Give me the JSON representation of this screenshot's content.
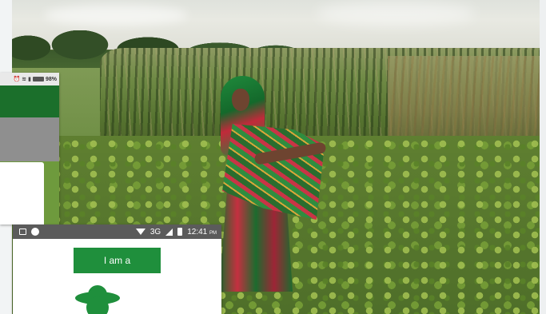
{
  "phone_back": {
    "status_bar": {
      "icons": [
        "alarm-icon",
        "wifi-icon",
        "signal-icon",
        "battery-icon"
      ],
      "battery": "98%"
    },
    "colors": {
      "appbar": "#1b6f2b",
      "content": "#8f8f8f"
    }
  },
  "phone_front": {
    "status_bar": {
      "left_icons": [
        "image-icon",
        "circle-icon"
      ],
      "network": "3G",
      "time": "12:41",
      "ampm": "PM"
    },
    "select_button": {
      "label": "I am a"
    },
    "colors": {
      "accent": "#1f8f3c",
      "status_bar": "#5b5b5b"
    }
  }
}
